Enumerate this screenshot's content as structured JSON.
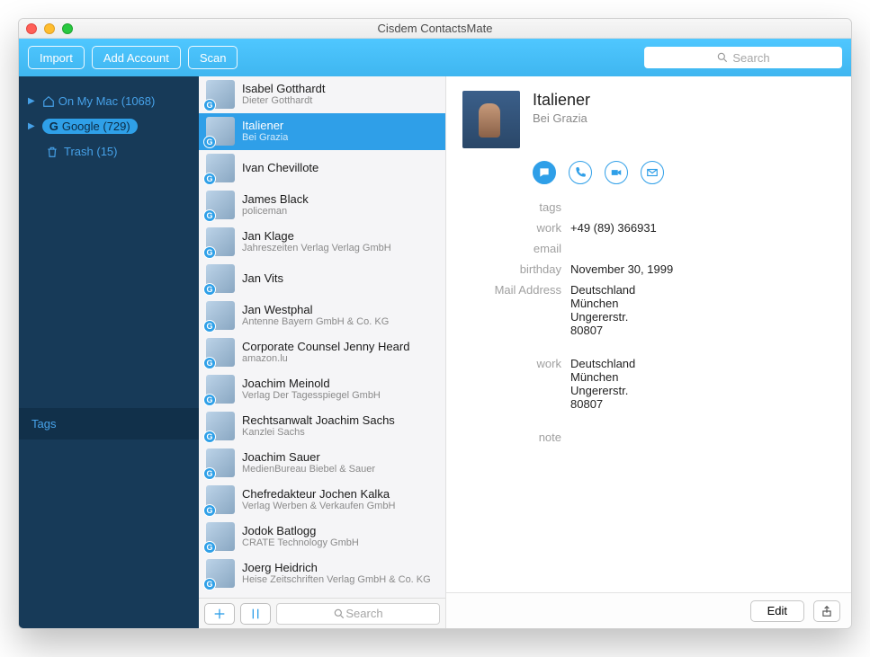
{
  "window": {
    "title": "Cisdem ContactsMate"
  },
  "toolbar": {
    "import": "Import",
    "add_account": "Add Account",
    "scan": "Scan",
    "search_placeholder": "Search"
  },
  "sidebar": {
    "on_my_mac": "On My Mac (1068)",
    "google": "Google (729)",
    "trash": "Trash (15)",
    "tags_header": "Tags"
  },
  "contacts": [
    {
      "name": "Isabel Gotthardt",
      "sub": "Dieter Gotthardt"
    },
    {
      "name": "Italiener",
      "sub": "Bei Grazia",
      "selected": true
    },
    {
      "name": "Ivan Chevillote",
      "sub": ""
    },
    {
      "name": "James Black",
      "sub": "policeman"
    },
    {
      "name": "Jan Klage",
      "sub": "Jahreszeiten Verlag Verlag GmbH"
    },
    {
      "name": "Jan Vits",
      "sub": ""
    },
    {
      "name": "Jan Westphal",
      "sub": "Antenne Bayern GmbH & Co. KG"
    },
    {
      "name": "Corporate Counsel Jenny Heard",
      "sub": "amazon.lu"
    },
    {
      "name": "Joachim Meinold",
      "sub": "Verlag Der Tagesspiegel GmbH"
    },
    {
      "name": "Rechtsanwalt Joachim Sachs",
      "sub": "Kanzlei Sachs"
    },
    {
      "name": "Joachim Sauer",
      "sub": "MedienBureau Biebel & Sauer"
    },
    {
      "name": "Chefredakteur Jochen Kalka",
      "sub": "Verlag Werben & Verkaufen GmbH"
    },
    {
      "name": "Jodok Batlogg",
      "sub": "CRATE Technology GmbH"
    },
    {
      "name": "Joerg Heidrich",
      "sub": "Heise Zeitschriften Verlag GmbH & Co. KG"
    }
  ],
  "list_footer": {
    "search_placeholder": "Search"
  },
  "detail": {
    "title": "Italiener",
    "subtitle": "Bei Grazia",
    "fields": [
      {
        "label": "tags",
        "value": ""
      },
      {
        "label": "work",
        "value": "+49 (89) 366931"
      },
      {
        "label": "email",
        "value": ""
      },
      {
        "label": "birthday",
        "value": "November 30, 1999"
      },
      {
        "label": "Mail Address",
        "value": "Deutschland\nMünchen\nUngererstr.\n80807"
      },
      {
        "label": "work",
        "value": "Deutschland\nMünchen\nUngererstr.\n80807"
      },
      {
        "label": "note",
        "value": ""
      }
    ],
    "edit": "Edit"
  }
}
